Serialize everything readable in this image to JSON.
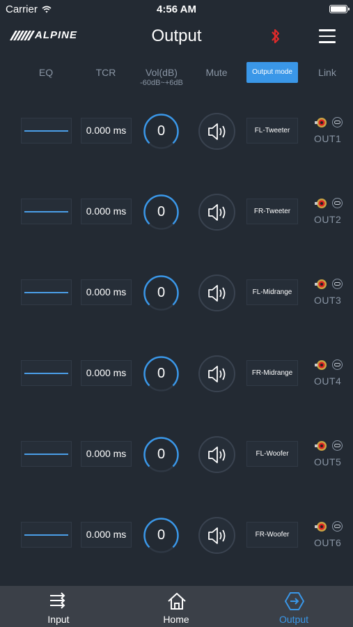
{
  "status": {
    "carrier": "Carrier",
    "time": "4:56 AM"
  },
  "header": {
    "logo": "ALPINE",
    "title": "Output"
  },
  "columns": {
    "eq": "EQ",
    "tcr": "TCR",
    "vol": "Vol(dB)",
    "vol_range": "-60dB~+6dB",
    "mute": "Mute",
    "mode": "Output mode",
    "link": "Link"
  },
  "rows": [
    {
      "tcr": "0.000 ms",
      "vol": "0",
      "mode": "FL-Tweeter",
      "out": "OUT1"
    },
    {
      "tcr": "0.000 ms",
      "vol": "0",
      "mode": "FR-Tweeter",
      "out": "OUT2"
    },
    {
      "tcr": "0.000 ms",
      "vol": "0",
      "mode": "FL-Midrange",
      "out": "OUT3"
    },
    {
      "tcr": "0.000 ms",
      "vol": "0",
      "mode": "FR-Midrange",
      "out": "OUT4"
    },
    {
      "tcr": "0.000 ms",
      "vol": "0",
      "mode": "FL-Woofer",
      "out": "OUT5"
    },
    {
      "tcr": "0.000 ms",
      "vol": "0",
      "mode": "FR-Woofer",
      "out": "OUT6"
    }
  ],
  "tabs": [
    {
      "label": "Input",
      "icon": "sliders-icon"
    },
    {
      "label": "Home",
      "icon": "home-icon"
    },
    {
      "label": "Output",
      "icon": "output-icon",
      "active": true
    }
  ],
  "colors": {
    "accent": "#3a97e8",
    "background": "#232a33",
    "bluetooth": "#e02a2a"
  }
}
